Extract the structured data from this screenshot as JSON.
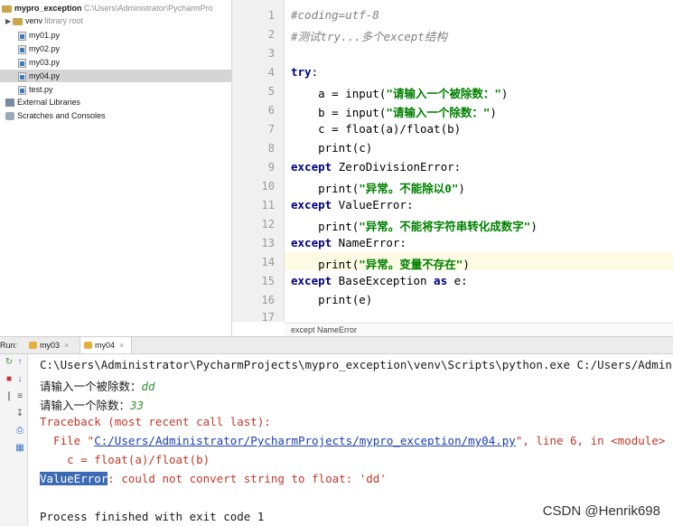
{
  "project": {
    "root_name": "mypro_exception",
    "root_path": "C:\\Users\\Administrator\\PycharmPro",
    "venv": "venv",
    "venv_note": "library root",
    "files": [
      "my01.py",
      "my02.py",
      "my03.py",
      "my04.py",
      "test.py"
    ],
    "selected_file": "my04.py",
    "external_libraries": "External Libraries",
    "scratches": "Scratches and Consoles"
  },
  "editor": {
    "line_numbers": [
      "1",
      "2",
      "3",
      "4",
      "5",
      "6",
      "7",
      "8",
      "9",
      "10",
      "11",
      "12",
      "13",
      "14",
      "15",
      "16",
      "17"
    ],
    "lines": {
      "l1": "#coding=utf-8",
      "l2": "#测试try...多个except结构",
      "l4_kw": "try",
      "l4_rest": ":",
      "l5_a": "    a = input(",
      "l5_s": "\"请输入一个被除数：\"",
      "l5_b": ")",
      "l6_a": "    b = input(",
      "l6_s": "\"请输入一个除数：\"",
      "l6_b": ")",
      "l7": "    c = float(a)/float(b)",
      "l8": "    print(c)",
      "l9_kw": "except",
      "l9_rest": " ZeroDivisionError:",
      "l10_a": "    print(",
      "l10_s": "\"异常。不能除以0\"",
      "l10_b": ")",
      "l11_kw": "except",
      "l11_rest": " ValueError:",
      "l12_a": "    print(",
      "l12_s": "\"异常。不能将字符串转化成数字\"",
      "l12_b": ")",
      "l13_kw": "except",
      "l13_rest": " NameError:",
      "l14_a": "    print(",
      "l14_s": "\"异常。变量不存在\"",
      "l14_b": ")",
      "l15_kw": "except",
      "l15_mid": " BaseException ",
      "l15_as": "as",
      "l15_rest": " e:",
      "l16": "    print(e)"
    },
    "breadcrumb": "except NameError"
  },
  "run": {
    "label": "Run:",
    "tabs": [
      "my03",
      "my04"
    ],
    "active_tab": "my04"
  },
  "console": {
    "cmd": "C:\\Users\\Administrator\\PycharmProjects\\mypro_exception\\venv\\Scripts\\python.exe C:/Users/Admini",
    "prompt1": "请输入一个被除数：",
    "input1": "dd",
    "prompt2": "请输入一个除数：",
    "input2": "33",
    "traceback": "Traceback (most recent call last):",
    "file_pre": "  File \"",
    "file_link": "C:/Users/Administrator/PycharmProjects/mypro_exception/my04.py",
    "file_post": "\", line 6, in <module>",
    "code_line": "    c = float(a)/float(b)",
    "error_type": "ValueError",
    "error_msg": ": could not convert string to float: 'dd'",
    "exit": "Process finished with exit code 1"
  },
  "watermark": "CSDN @Henrik698",
  "colors": {
    "keyword": "#000080",
    "string": "#008000",
    "comment": "#808080",
    "error": "#c0392b",
    "link": "#1a3fb4",
    "selection": "#3c6bb5"
  }
}
